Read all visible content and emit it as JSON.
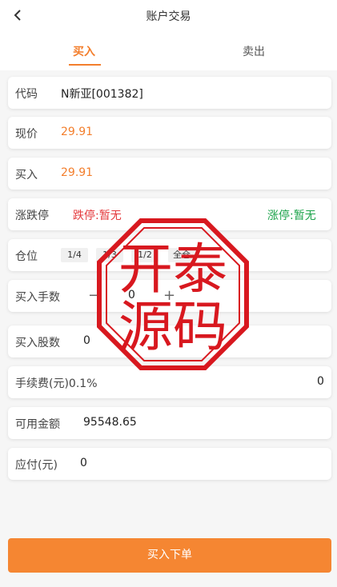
{
  "header": {
    "title": "账户交易",
    "back_icon": "chevron-left-icon"
  },
  "tabs": [
    {
      "label": "买入",
      "active": true
    },
    {
      "label": "卖出",
      "active": false
    }
  ],
  "form": {
    "code": {
      "label": "代码",
      "value": "N新亚[001382]"
    },
    "current_price": {
      "label": "现价",
      "value": "29.91"
    },
    "buy_price": {
      "label": "买入",
      "value": "29.91"
    },
    "limits": {
      "label": "涨跌停",
      "down": "跌停:暂无",
      "up": "涨停:暂无"
    },
    "position": {
      "label": "仓位",
      "options": [
        "1/4",
        "1/3",
        "1/2",
        "全仓"
      ]
    },
    "lots": {
      "label": "买入手数",
      "value": "0",
      "minus": "−",
      "plus": "+"
    },
    "shares": {
      "label": "买入股数",
      "value": "0"
    },
    "fee": {
      "label": "手续费(元)0.1%",
      "value": "0"
    },
    "available": {
      "label": "可用金额",
      "value": "95548.65"
    },
    "payable": {
      "label": "应付(元)",
      "value": "0"
    }
  },
  "submit_label": "买入下单",
  "watermark": {
    "line1": "开泰",
    "line2": "源码"
  },
  "colors": {
    "accent": "#f37e2c",
    "down": "#e4393c",
    "up": "#1ca34b",
    "stamp": "#d8181f"
  }
}
